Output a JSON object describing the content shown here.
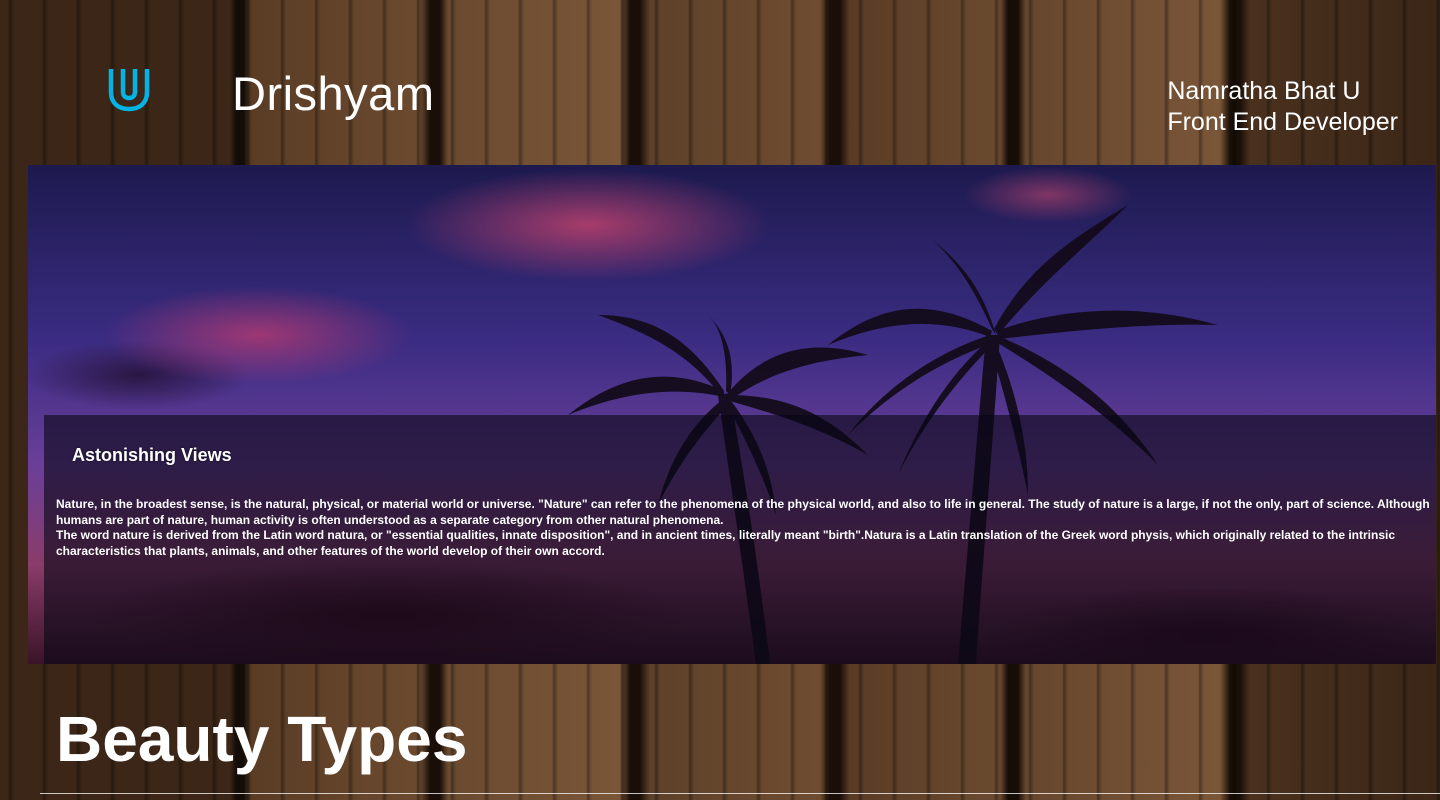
{
  "header": {
    "logo_icon": "udacity-u-logo-icon",
    "logo_color": "#02b3e4",
    "site_title": "Drishyam",
    "author_name": "Namratha Bhat U",
    "author_role": "Front End Developer"
  },
  "hero": {
    "image_icon": "sunset-palm-trees-image",
    "heading": "Astonishing Views",
    "paragraphs": [
      "Nature, in the broadest sense, is the natural, physical, or material world or universe. \"Nature\" can refer to the phenomena of the physical world, and also to life in general. The study of nature is a large, if not the only, part of science. Although humans are part of nature, human activity is often understood as a separate category from other natural phenomena.",
      "The word nature is derived from the Latin word natura, or \"essential qualities, innate disposition\", and in ancient times, literally meant \"birth\".Natura is a Latin translation of the Greek word physis, which originally related to the intrinsic characteristics that plants, animals, and other features of the world develop of their own accord."
    ]
  },
  "section": {
    "title": "Beauty Types"
  }
}
